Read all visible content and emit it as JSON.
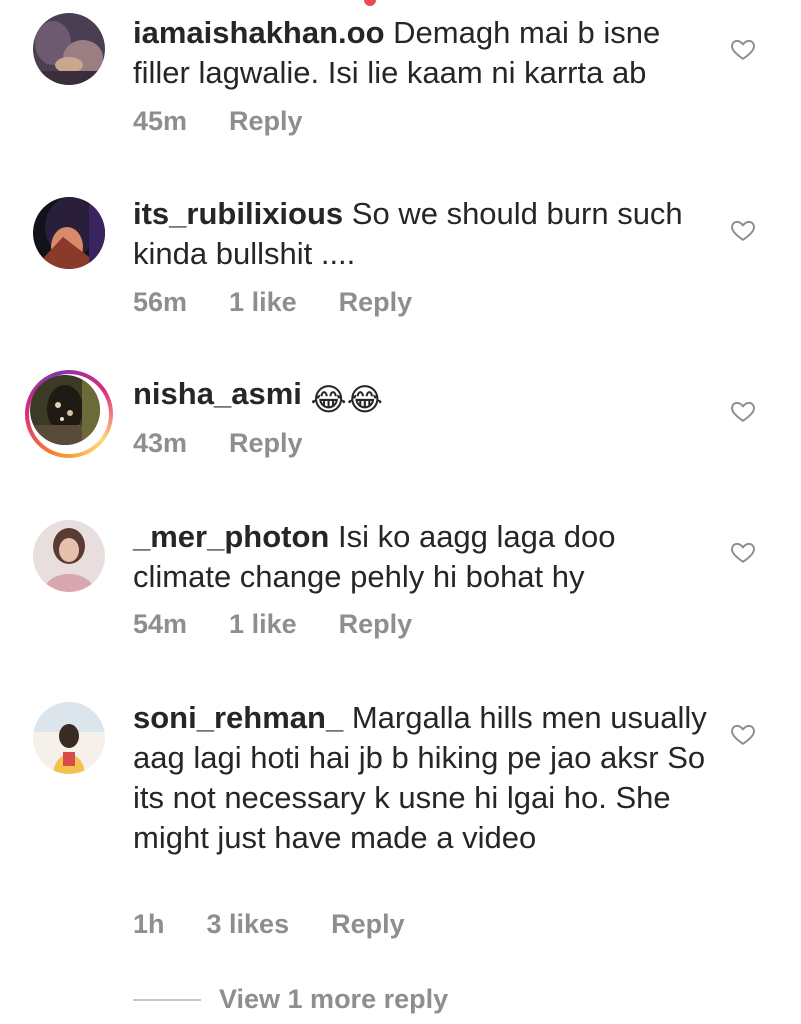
{
  "comments": [
    {
      "username": "iamaishakhan.oo",
      "text": "Demagh mai b isne filler lagwalie. Isi lie kaam ni karrta ab",
      "time": "45m",
      "likes": "",
      "reply": "Reply"
    },
    {
      "username": "its_rubilixious",
      "text": "So we should burn such kinda bullshit ....",
      "time": "56m",
      "likes": "1 like",
      "reply": "Reply"
    },
    {
      "username": "nisha_asmi",
      "text": "😂😂",
      "time": "43m",
      "likes": "",
      "reply": "Reply"
    },
    {
      "username": "_mer_photon",
      "text": "Isi ko aagg laga doo climate change pehly hi bohat hy",
      "time": "54m",
      "likes": "1 like",
      "reply": "Reply"
    },
    {
      "username": "soni_rehman_",
      "text": "Margalla hills men usually aag lagi hoti hai jb b hiking pe jao aksr So its not necessary k usne hi lgai ho. She might just have made a video",
      "time": "1h",
      "likes": "3 likes",
      "reply": "Reply"
    }
  ],
  "view_more_replies": "View 1 more reply",
  "icons": {
    "like": "heart-outline-icon",
    "story_ring": "story-ring"
  },
  "colors": {
    "text": "#262626",
    "secondary": "#8e8e8e",
    "heart_stroke": "#8e8e8e",
    "notification_dot": "#ed4956"
  }
}
